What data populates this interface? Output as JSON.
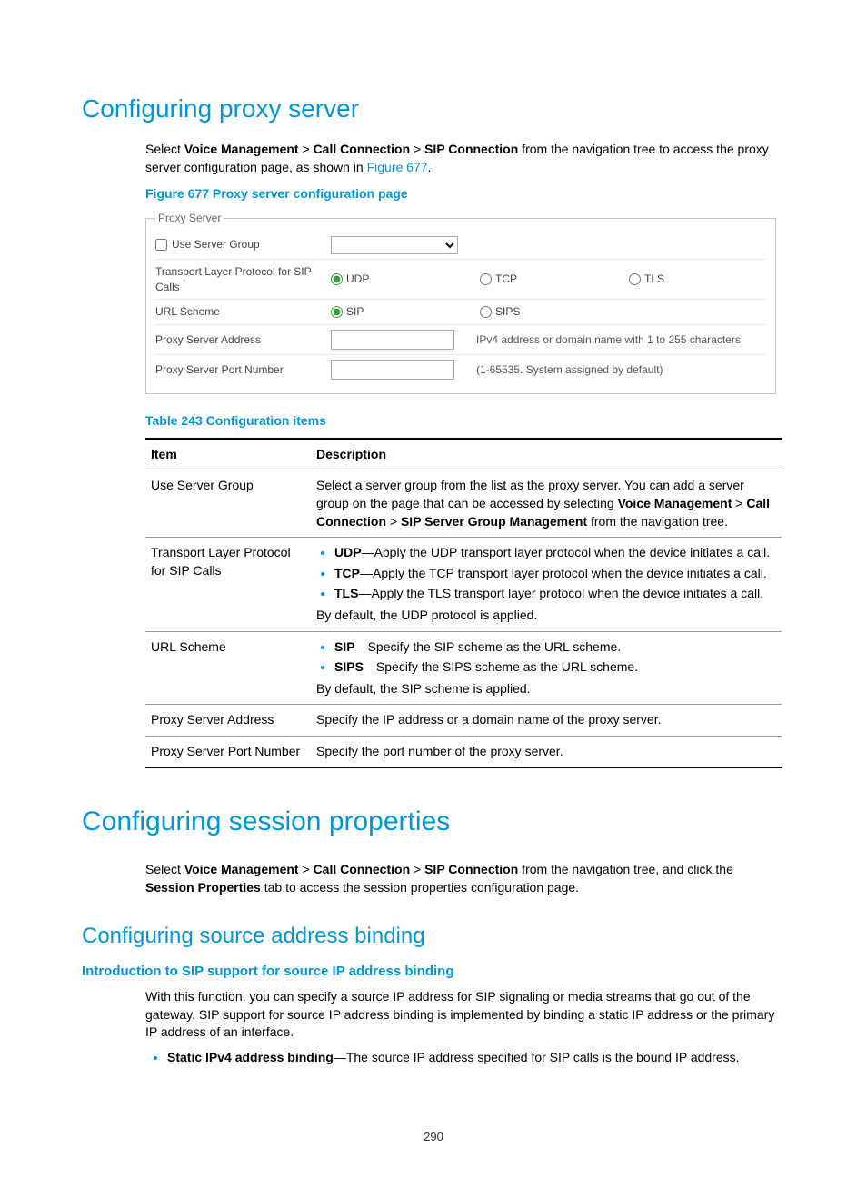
{
  "page_number": "290",
  "section1": {
    "heading": "Configuring proxy server",
    "intro_pre": "Select ",
    "nav1": "Voice Management",
    "nav_sep": " > ",
    "nav2": "Call Connection",
    "nav3": "SIP Connection",
    "intro_post": " from the navigation tree to access the proxy server configuration page, as shown in ",
    "figure_link": "Figure 677",
    "intro_end": ".",
    "figure_caption": "Figure 677 Proxy server configuration page"
  },
  "figure": {
    "legend": "Proxy Server",
    "use_server_group": "Use Server Group",
    "transport_label": "Transport Layer Protocol for SIP Calls",
    "udp": "UDP",
    "tcp": "TCP",
    "tls": "TLS",
    "url_scheme_label": "URL Scheme",
    "sip": "SIP",
    "sips": "SIPS",
    "address_label": "Proxy Server Address",
    "address_hint": "IPv4 address or domain name with 1 to 255 characters",
    "port_label": "Proxy Server Port Number",
    "port_hint": "(1-65535. System assigned by default)"
  },
  "table": {
    "caption": "Table 243 Configuration items",
    "header_item": "Item",
    "header_desc": "Description",
    "rows": {
      "r1": {
        "item": "Use Server Group",
        "d1": "Select a server group from the list as the proxy server. You can add a server group on the page that can be accessed by selecting ",
        "b1": "Voice Management",
        "sep": " > ",
        "b2": "Call Connection",
        "b3": "SIP Server Group Management",
        "d2": " from the navigation tree."
      },
      "r2": {
        "item": "Transport Layer Protocol for SIP Calls",
        "udp_b": "UDP",
        "udp_t": "—Apply the UDP transport layer protocol when the device initiates a call.",
        "tcp_b": "TCP",
        "tcp_t": "—Apply the TCP transport layer protocol when the device initiates a call.",
        "tls_b": "TLS",
        "tls_t": "—Apply the TLS transport layer protocol when the device initiates a call.",
        "default": "By default, the UDP protocol is applied."
      },
      "r3": {
        "item": "URL Scheme",
        "sip_b": "SIP",
        "sip_t": "—Specify the SIP scheme as the URL scheme.",
        "sips_b": "SIPS",
        "sips_t": "—Specify the SIPS scheme as the URL scheme.",
        "default": "By default, the SIP scheme is applied."
      },
      "r4": {
        "item": "Proxy Server Address",
        "desc": "Specify the IP address or a domain name of the proxy server."
      },
      "r5": {
        "item": "Proxy Server Port Number",
        "desc": "Specify the port number of the proxy server."
      }
    }
  },
  "section2": {
    "heading": "Configuring session properties",
    "intro_pre": "Select ",
    "nav1": "Voice Management",
    "nav_sep": " > ",
    "nav2": "Call Connection",
    "nav3": "SIP Connection",
    "intro_mid": " from the navigation tree, and click the ",
    "tab": "Session Properties",
    "intro_end": " tab to access the session properties configuration page."
  },
  "section3": {
    "heading": "Configuring source address binding",
    "subheading": "Introduction to SIP support for source IP address binding",
    "para": "With this function, you can specify a source IP address for SIP signaling or media streams that go out of the gateway. SIP support for source IP address binding is implemented by binding a static IP address or the primary IP address of an interface.",
    "bullet_b": "Static IPv4 address binding",
    "bullet_t": "—The source IP address specified for SIP calls is the bound IP address."
  }
}
